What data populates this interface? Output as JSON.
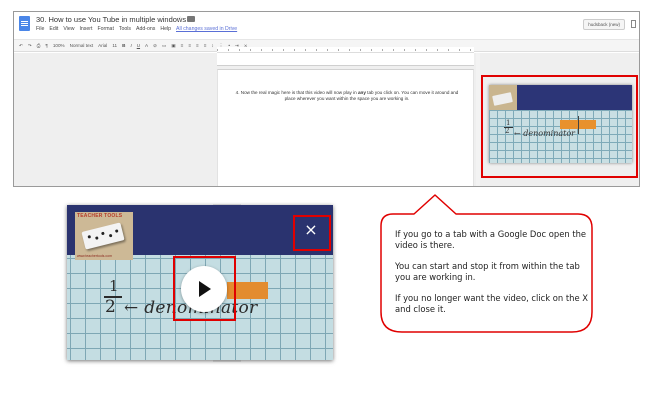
{
  "doc": {
    "title": "30. How to use You Tube in multiple windows",
    "menu": [
      "File",
      "Edit",
      "View",
      "Insert",
      "Format",
      "Tools",
      "Add-ons",
      "Help"
    ],
    "saved_status": "All changes saved in Drive",
    "user_button": "hudsback (new)",
    "toolbar": {
      "zoom": "100%",
      "style": "Normal text",
      "font": "Arial",
      "size": "11"
    },
    "step_text_prefix": "4.  Now the real magic here is that this video will now play in ",
    "step_text_bold": "any",
    "step_text_suffix": " tab you click on. You can move it around and place wherever you want within the space you are working in."
  },
  "video": {
    "logo_title": "TEACHER TOOLS",
    "logo_footer": "www.teachertools.com",
    "fraction_numerator": "1",
    "fraction_denominator": "2",
    "fraction_word": "← denominator",
    "close_glyph": "×"
  },
  "mini_video": {
    "fraction_numerator": "1",
    "fraction_denominator": "2",
    "fraction_word": "← denominator"
  },
  "bubble": {
    "paragraphs": [
      "If you go to a tab with a Google Doc open the video is there.",
      "You can start and stop it from within the tab you are working in.",
      "If you no longer want the video, click on the X and close it."
    ]
  },
  "colors": {
    "highlight": "#e00000",
    "video_band": "#2a336f",
    "video_grid_bg": "#c4dde2",
    "accent_orange": "#e38c2f",
    "doc_blue": "#4a86e8"
  }
}
